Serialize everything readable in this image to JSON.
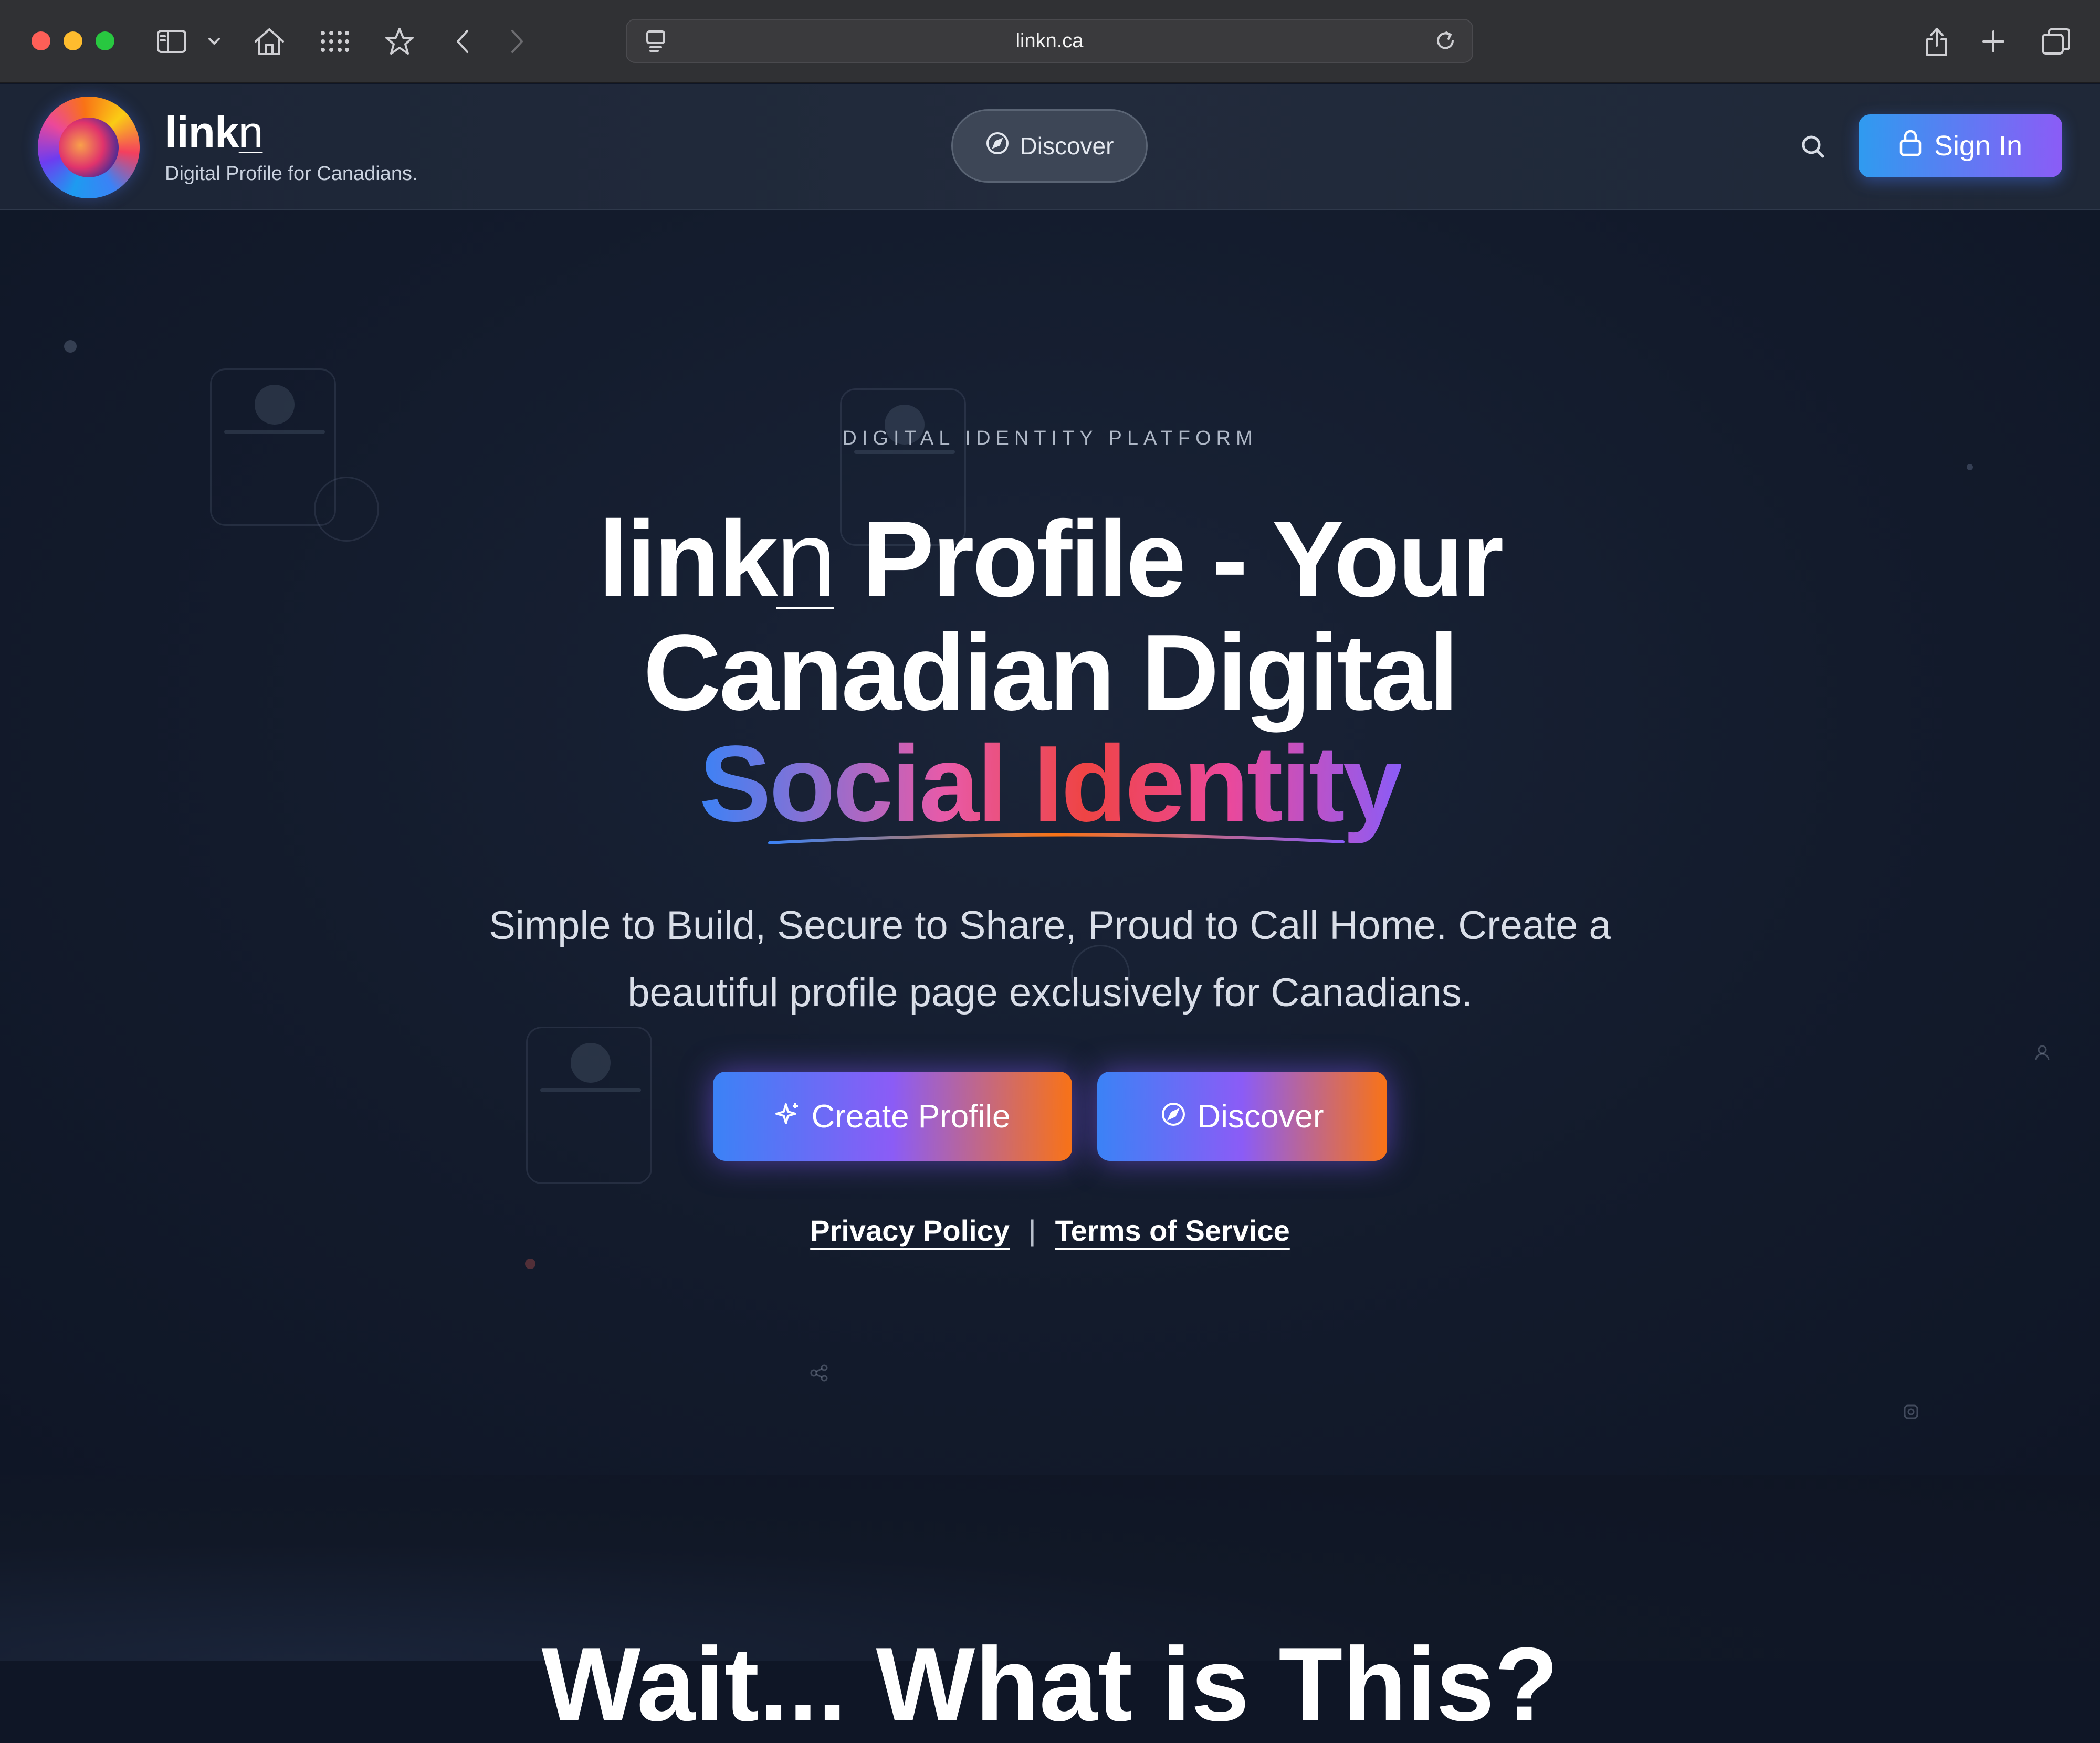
{
  "browser": {
    "url": "linkn.ca"
  },
  "header": {
    "brand_prefix": "link",
    "brand_suffix": "n",
    "tagline": "Digital Profile for Canadians.",
    "discover_label": "Discover",
    "signin_label": "Sign In"
  },
  "hero": {
    "eyebrow": "DIGITAL IDENTITY PLATFORM",
    "title_prefix": "link",
    "title_suffix_n": "n",
    "title_line1_rest": " Profile - Your",
    "title_line2": "Canadian Digital",
    "title_line3": "Social Identity",
    "subtitle": "Simple to Build, Secure to Share, Proud to Call Home. Create a beautiful profile page exclusively for Canadians.",
    "create_label": "Create Profile",
    "discover_label": "Discover",
    "privacy_label": "Privacy Policy",
    "separator": "|",
    "terms_label": "Terms of Service"
  },
  "next_section": {
    "title": "Wait... What is This?"
  },
  "colors": {
    "background": "#0f1626",
    "accent_blue": "#3b82f6",
    "accent_purple": "#8b5cf6",
    "accent_orange": "#f97316",
    "accent_red": "#ef4444"
  }
}
